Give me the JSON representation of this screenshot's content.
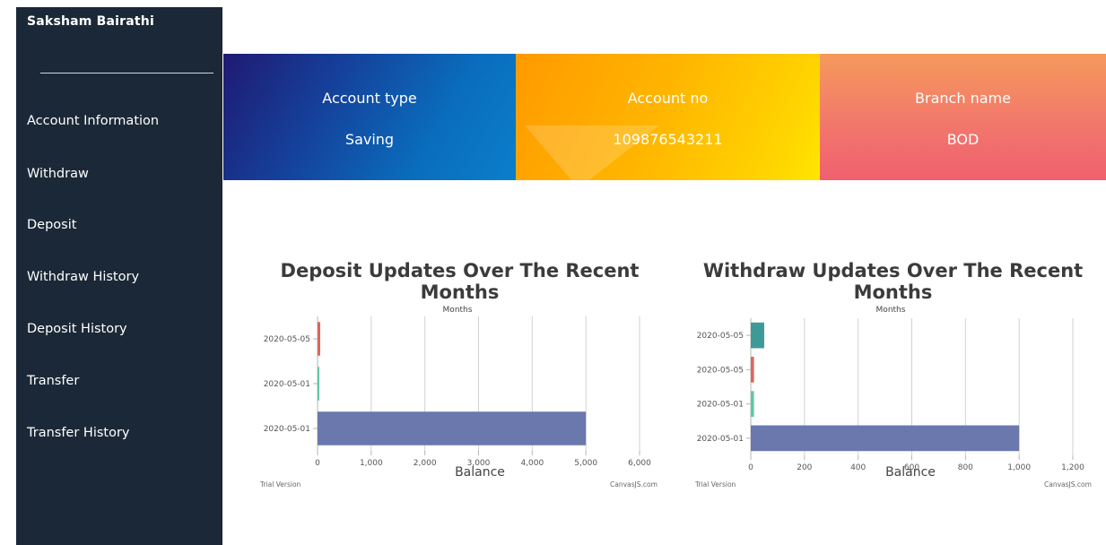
{
  "sidebar": {
    "user_name": "Saksham Bairathi",
    "items": [
      {
        "label": "Account Information"
      },
      {
        "label": "Withdraw"
      },
      {
        "label": "Deposit"
      },
      {
        "label": "Withdraw History"
      },
      {
        "label": "Deposit History"
      },
      {
        "label": "Transfer"
      },
      {
        "label": "Transfer History"
      }
    ]
  },
  "cards": [
    {
      "label": "Account type",
      "value": "Saving"
    },
    {
      "label": "Account no",
      "value": "109876543211"
    },
    {
      "label": "Branch name",
      "value": "BOD"
    }
  ],
  "chart_data": [
    {
      "type": "bar",
      "orientation": "horizontal",
      "title": "Deposit Updates Over The Recent Months",
      "xlabel": "Balance",
      "ylabel": "Months",
      "categories": [
        "2020-05-05",
        "2020-05-01",
        "2020-05-01"
      ],
      "values": [
        50,
        10,
        5000
      ],
      "colors": [
        "#e0655a",
        "#5fc9a5",
        "#6b78ad"
      ],
      "xlim": [
        0,
        6000
      ],
      "xticks": [
        "0",
        "1,000",
        "2,000",
        "3,000",
        "4,000",
        "5,000",
        "6,000"
      ],
      "grid": true,
      "footer_left": "Trial Version",
      "footer_right": "CanvasJS.com"
    },
    {
      "type": "bar",
      "orientation": "horizontal",
      "title": "Withdraw Updates Over The Recent Months",
      "xlabel": "Balance",
      "ylabel": "Months",
      "categories": [
        "2020-05-05",
        "2020-05-05",
        "2020-05-01",
        "2020-05-01"
      ],
      "values": [
        50,
        12,
        12,
        1000
      ],
      "colors": [
        "#3e9a96",
        "#e0655a",
        "#5fc9a5",
        "#6b78ad"
      ],
      "xlim": [
        0,
        1200
      ],
      "xticks": [
        "0",
        "200",
        "400",
        "600",
        "800",
        "1,000",
        "1,200"
      ],
      "grid": true,
      "footer_left": "Trial Version",
      "footer_right": "CanvasJS.com"
    }
  ]
}
